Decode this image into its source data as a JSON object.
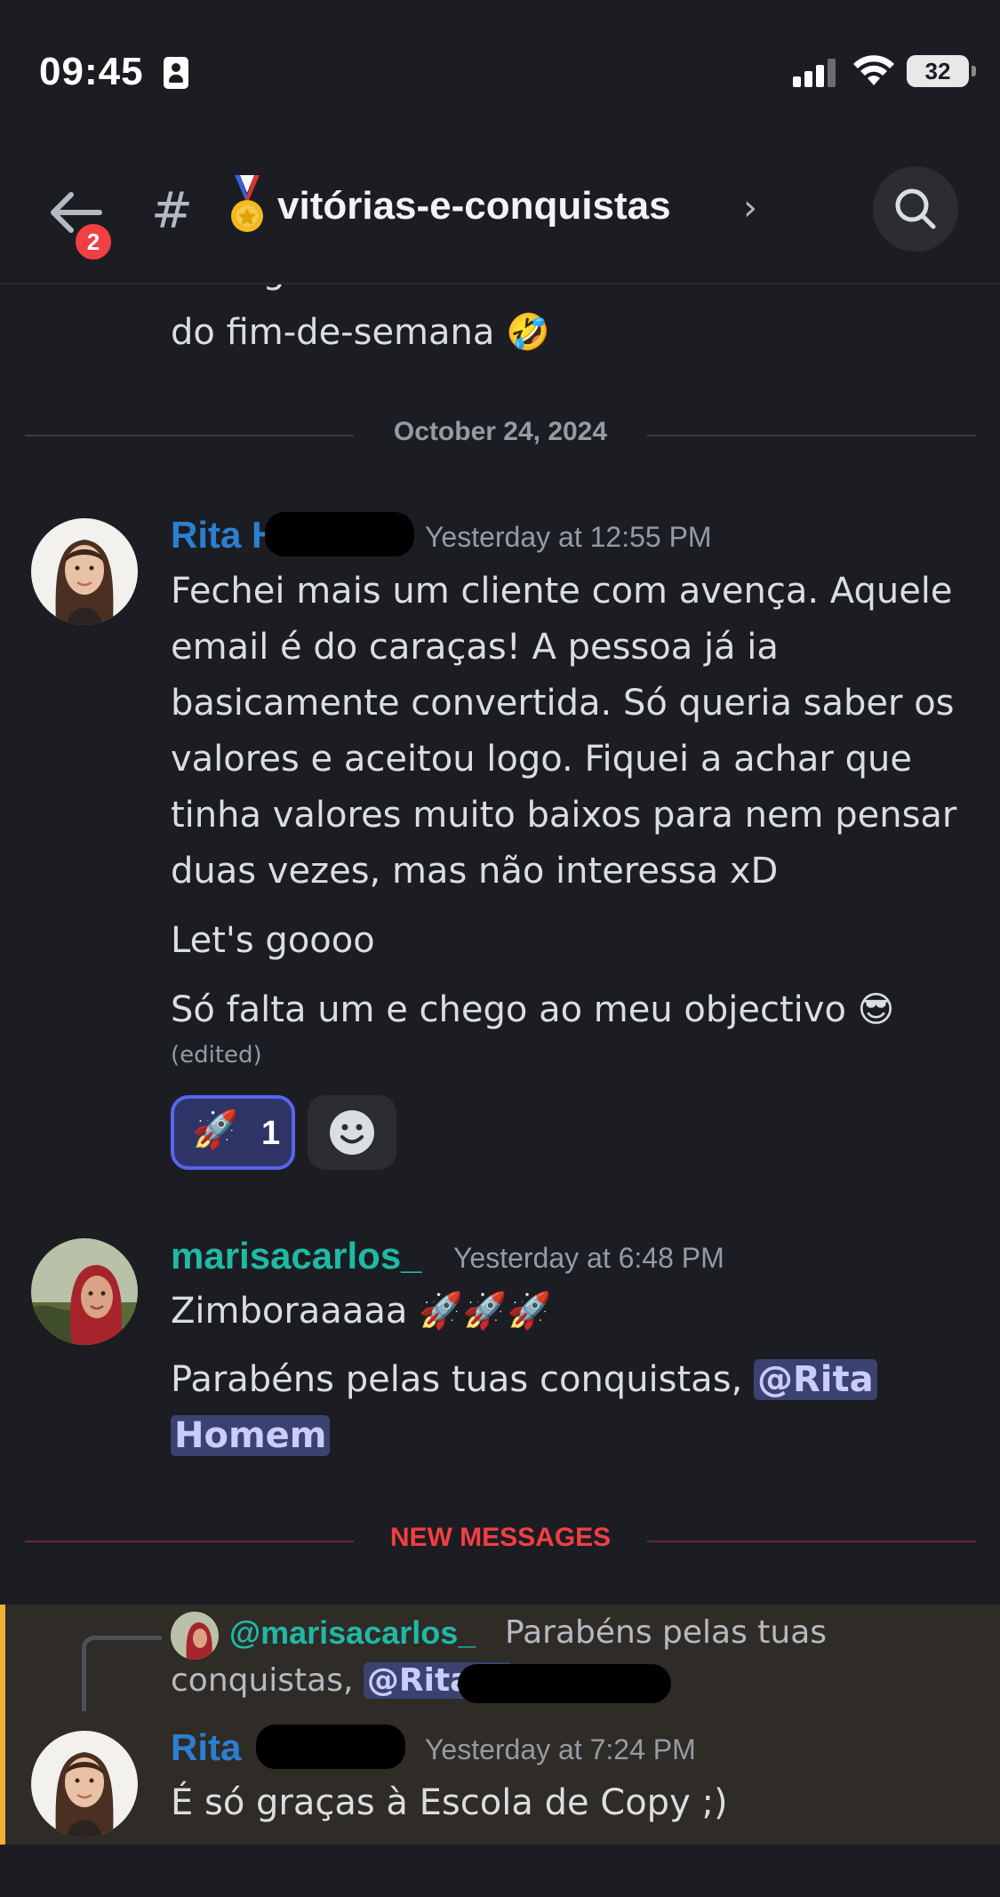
{
  "status_bar": {
    "time": "09:45",
    "battery": "32"
  },
  "header": {
    "back_badge": "2",
    "hash": "#",
    "channel_name": "vitórias-e-conquistas",
    "chevron": "›"
  },
  "chat": {
    "cut_message": {
      "line1": "as segundas à malta ainda está a ver emails",
      "line2": "do fim-de-semana 🤣"
    },
    "date_divider": "October 24, 2024",
    "messages": [
      {
        "author": "Rita H",
        "timestamp": "Yesterday at 12:55 PM",
        "lines": [
          "Fechei mais um cliente com avença. Aquele",
          "email é do caraças! A pessoa já ia",
          "basicamente convertida. Só queria saber os",
          "valores e aceitou logo. Fiquei a achar que",
          "tinha valores muito baixos para nem pensar",
          "duas vezes, mas não interessa xD"
        ],
        "line2": "Let's goooo",
        "line3": "Só falta um e chego ao meu objectivo 😎",
        "edited": "(edited)",
        "reaction": {
          "emoji": "🚀",
          "count": "1"
        }
      },
      {
        "author": "marisacarlos_",
        "timestamp": "Yesterday at 6:48 PM",
        "line1": "Zimboraaaaa 🚀🚀🚀",
        "line2_text": "Parabéns pelas tuas conquistas, ",
        "mention_part1": "@Rita",
        "mention_part2": "Homem"
      }
    ],
    "new_messages_label": "NEW MESSAGES",
    "reply": {
      "author": "@marisacarlos_",
      "text_part1": "Parabéns pelas tuas",
      "text_part2": "conquistas, ",
      "mention": "@Rita H"
    },
    "last_message": {
      "author": "Rita",
      "timestamp": "Yesterday at 7:24 PM",
      "text": "É só graças à Escola de Copy ;)"
    }
  },
  "colors": {
    "background": "#1c1d22",
    "rita_name": "#2b7fd1",
    "marisa_name": "#1fb9a6",
    "new_messages": "#f23f43",
    "mention_bg": "#3c4270",
    "reaction_border": "#5865f2",
    "highlight_bar": "#f0b132"
  }
}
